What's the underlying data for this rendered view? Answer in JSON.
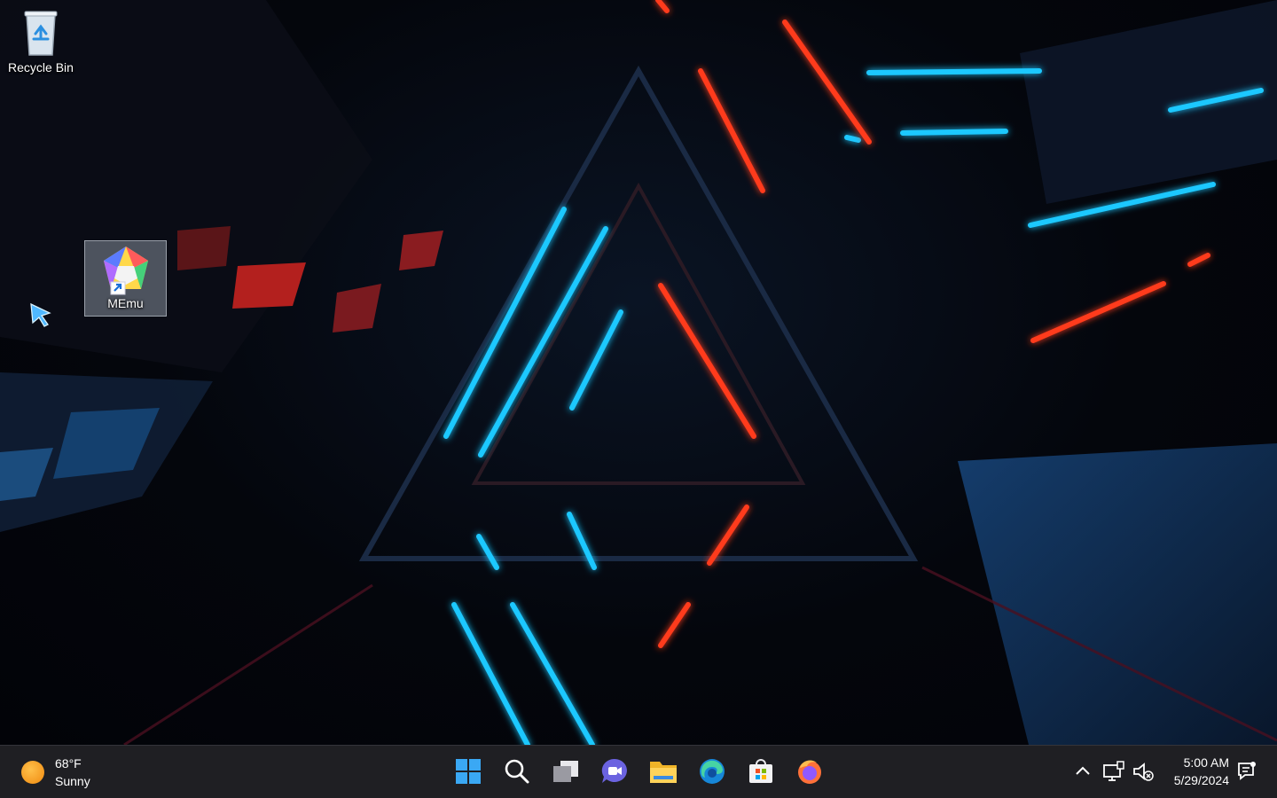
{
  "desktop": {
    "icons": [
      {
        "label": "Recycle Bin",
        "icon": "recycle-bin-icon"
      },
      {
        "label": "MEmu",
        "icon": "memu-icon",
        "selected": true
      }
    ]
  },
  "taskbar": {
    "weather": {
      "temperature": "68°F",
      "condition": "Sunny",
      "icon": "sun-icon"
    },
    "apps": [
      {
        "name": "start",
        "icon": "windows-start-icon"
      },
      {
        "name": "search",
        "icon": "search-icon"
      },
      {
        "name": "task-view",
        "icon": "task-view-icon"
      },
      {
        "name": "chat",
        "icon": "teams-chat-icon"
      },
      {
        "name": "file-explorer",
        "icon": "folder-icon"
      },
      {
        "name": "edge",
        "icon": "edge-icon"
      },
      {
        "name": "store",
        "icon": "store-icon"
      },
      {
        "name": "firefox",
        "icon": "firefox-icon"
      }
    ],
    "tray": {
      "time": "5:00 AM",
      "date": "5/29/2024"
    }
  },
  "colors": {
    "taskbar_bg": "#1f1f23",
    "neon_blue": "#1ec8ff",
    "neon_red": "#ff3a1a"
  }
}
